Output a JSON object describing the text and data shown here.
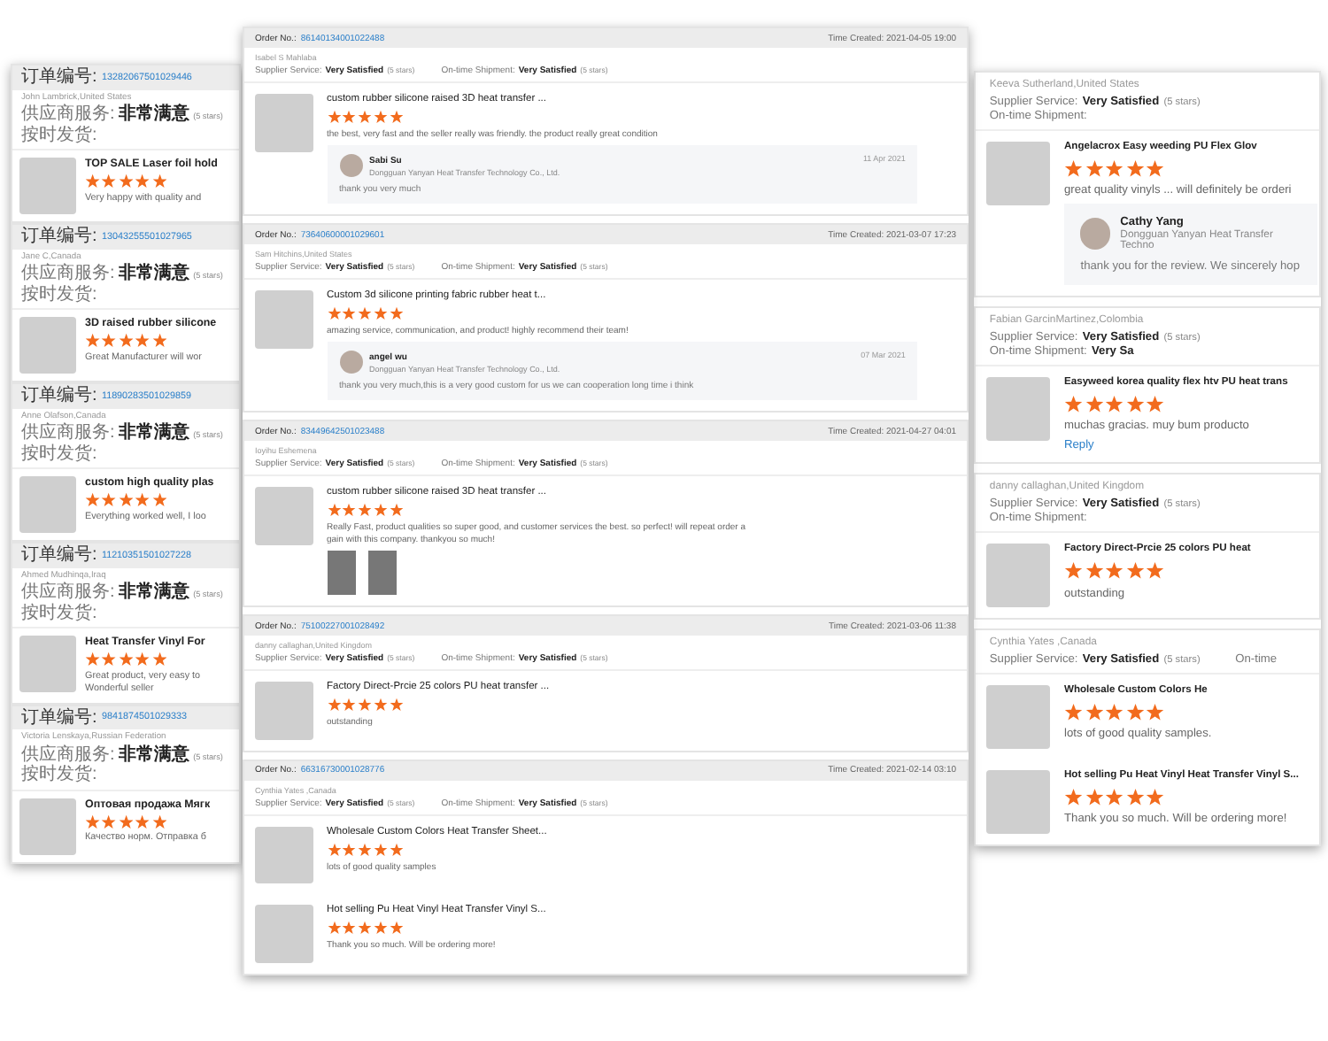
{
  "left_panel": {
    "orders": [
      {
        "order_label": "订单编号:",
        "order_no": "13282067501029446",
        "buyer": "John Lambrick,United States",
        "service": {
          "label": "供应商服务:",
          "value": "非常满意",
          "stars_text": "(5 stars)"
        },
        "shipment": {
          "label": "按时发货:"
        },
        "items": [
          {
            "title": "TOP SALE Laser foil hold",
            "stars": 5,
            "comment": [
              "Very happy with quality and"
            ]
          }
        ]
      },
      {
        "order_label": "订单编号:",
        "order_no": "13043255501027965",
        "buyer": "Jane C,Canada",
        "service": {
          "label": "供应商服务:",
          "value": "非常满意",
          "stars_text": "(5 stars)"
        },
        "shipment": {
          "label": "按时发货:"
        },
        "items": [
          {
            "title": "3D raised rubber silicone",
            "stars": 5,
            "comment": [
              "Great Manufacturer will wor"
            ]
          }
        ]
      },
      {
        "order_label": "订单编号:",
        "order_no": "11890283501029859",
        "buyer": "Anne Olafson,Canada",
        "service": {
          "label": "供应商服务:",
          "value": "非常满意",
          "stars_text": "(5 stars)"
        },
        "shipment": {
          "label": "按时发货:"
        },
        "items": [
          {
            "title": "custom high quality plas",
            "stars": 5,
            "comment": [
              "Everything worked well, I loo"
            ]
          }
        ]
      },
      {
        "order_label": "订单编号:",
        "order_no": "11210351501027228",
        "buyer": "Ahmed Mudhinqa,Iraq",
        "service": {
          "label": "供应商服务:",
          "value": "非常满意",
          "stars_text": "(5 stars)"
        },
        "shipment": {
          "label": "按时发货:"
        },
        "items": [
          {
            "title": "Heat Transfer Vinyl For",
            "stars": 5,
            "comment": [
              "Great product, very easy to",
              "Wonderful seller"
            ]
          }
        ]
      },
      {
        "order_label": "订单编号:",
        "order_no": "9841874501029333",
        "buyer": "Victoria Lenskaya,Russian Federation",
        "service": {
          "label": "供应商服务:",
          "value": "非常满意",
          "stars_text": "(5 stars)"
        },
        "shipment": {
          "label": "按时发货:"
        },
        "items": [
          {
            "title": "Оптовая продажа Мягк",
            "stars": 5,
            "comment": [
              "Качество норм. Отправка б"
            ]
          }
        ]
      }
    ]
  },
  "middle_panel": {
    "orders": [
      {
        "order_label": "Order No.:",
        "order_no": "86140134001022488",
        "time_created": "Time Created: 2021-04-05 19:00",
        "buyer": "Isabel S Mahlaba",
        "service": {
          "label": "Supplier Service:",
          "value": "Very Satisfied",
          "stars_text": "(5 stars)"
        },
        "shipment": {
          "label": "On-time Shipment:",
          "value": "Very Satisfied",
          "stars_text": "(5 stars)"
        },
        "items": [
          {
            "title": "custom rubber silicone raised 3D heat transfer ...",
            "stars": 5,
            "comment": [
              "the best, very fast and the seller really was friendly. the product really great condition"
            ],
            "reply": {
              "name": "Sabi Su",
              "date": "11 Apr 2021",
              "company": "Dongguan Yanyan Heat Transfer Technology Co., Ltd.",
              "text": "thank you very much"
            }
          }
        ]
      },
      {
        "order_label": "Order No.:",
        "order_no": "73640600001029601",
        "time_created": "Time Created: 2021-03-07 17:23",
        "buyer": "Sam Hitchins,United States",
        "service": {
          "label": "Supplier Service:",
          "value": "Very Satisfied",
          "stars_text": "(5 stars)"
        },
        "shipment": {
          "label": "On-time Shipment:",
          "value": "Very Satisfied",
          "stars_text": "(5 stars)"
        },
        "items": [
          {
            "title": "Custom 3d silicone printing fabric rubber heat t...",
            "stars": 5,
            "comment": [
              "amazing service, communication, and product! highly recommend their team!"
            ],
            "reply": {
              "name": "angel wu",
              "date": "07 Mar 2021",
              "company": "Dongguan Yanyan Heat Transfer Technology Co., Ltd.",
              "text": "thank you very much,this is a very good custom for us we can cooperation long time i think"
            }
          }
        ]
      },
      {
        "order_label": "Order No.:",
        "order_no": "83449642501023488",
        "time_created": "Time Created: 2021-04-27 04:01",
        "buyer": "Ioyihu Eshemena",
        "service": {
          "label": "Supplier Service:",
          "value": "Very Satisfied",
          "stars_text": "(5 stars)"
        },
        "shipment": {
          "label": "On-time Shipment:",
          "value": "Very Satisfied",
          "stars_text": "(5 stars)"
        },
        "items": [
          {
            "title": "custom rubber silicone raised 3D heat transfer ...",
            "stars": 5,
            "comment": [
              "Really Fast, product qualities so super good, and customer services the best. so perfect! will repeat order a",
              "gain with this company. thankyou so much!"
            ],
            "photos": [
              {
                "kind": "photo"
              },
              {
                "kind": "photo"
              }
            ]
          }
        ]
      },
      {
        "order_label": "Order No.:",
        "order_no": "75100227001028492",
        "time_created": "Time Created: 2021-03-06 11:38",
        "buyer": "danny callaghan,United Kingdom",
        "service": {
          "label": "Supplier Service:",
          "value": "Very Satisfied",
          "stars_text": "(5 stars)"
        },
        "shipment": {
          "label": "On-time Shipment:",
          "value": "Very Satisfied",
          "stars_text": "(5 stars)"
        },
        "items": [
          {
            "title": "Factory Direct-Prcie 25 colors PU heat transfer ...",
            "stars": 5,
            "comment": [
              "outstanding"
            ]
          }
        ]
      },
      {
        "order_label": "Order No.:",
        "order_no": "66316730001028776",
        "time_created": "Time Created: 2021-02-14 03:10",
        "buyer": "Cynthia Yates ,Canada",
        "service": {
          "label": "Supplier Service:",
          "value": "Very Satisfied",
          "stars_text": "(5 stars)"
        },
        "shipment": {
          "label": "On-time Shipment:",
          "value": "Very Satisfied",
          "stars_text": "(5 stars)"
        },
        "items": [
          {
            "title": "Wholesale Custom Colors Heat Transfer Sheet...",
            "stars": 5,
            "comment": [
              "lots of good quality samples"
            ]
          },
          {
            "title": "Hot selling Pu Heat Vinyl Heat Transfer Vinyl S...",
            "stars": 5,
            "comment": [
              "Thank you so much. Will be ordering more!"
            ]
          }
        ]
      }
    ]
  },
  "right_panel": {
    "orders": [
      {
        "buyer": "Keeva Sutherland,United States",
        "service": {
          "label": "Supplier Service:",
          "value": "Very Satisfied",
          "stars_text": "(5 stars)"
        },
        "shipment": {
          "label": "On-time Shipment:"
        },
        "items": [
          {
            "title": "Angelacrox Easy weeding PU Flex Glov",
            "stars": 5,
            "comment": [
              "great quality vinyls ... will definitely be orderi"
            ],
            "reply": {
              "name": "Cathy Yang",
              "company": "Dongguan Yanyan Heat Transfer Techno",
              "text": "thank you for the review. We sincerely hop"
            }
          }
        ]
      },
      {
        "buyer": "Fabian GarcinMartinez,Colombia",
        "service": {
          "label": "Supplier Service:",
          "value": "Very Satisfied",
          "stars_text": "(5 stars)"
        },
        "shipment": {
          "label": "On-time Shipment:",
          "value": "Very Sa"
        },
        "items": [
          {
            "title": "Easyweed korea quality flex htv PU heat trans",
            "stars": 5,
            "comment": [
              "muchas gracias. muy bum producto"
            ],
            "reply_link": "Reply"
          }
        ]
      },
      {
        "buyer": "danny callaghan,United Kingdom",
        "service": {
          "label": "Supplier Service:",
          "value": "Very Satisfied",
          "stars_text": "(5 stars)"
        },
        "shipment": {
          "label": "On-time Shipment:"
        },
        "items": [
          {
            "title": "Factory Direct-Prcie 25 colors PU heat",
            "stars": 5,
            "comment": [
              "outstanding"
            ]
          }
        ]
      },
      {
        "buyer": "Cynthia Yates ,Canada",
        "service": {
          "label": "Supplier Service:",
          "value": "Very Satisfied",
          "stars_text": "(5 stars)"
        },
        "shipment": {
          "label": "On-time"
        },
        "items": [
          {
            "title": "Wholesale Custom Colors He",
            "stars": 5,
            "comment": [
              "lots of good quality samples."
            ]
          },
          {
            "title": "Hot selling Pu Heat Vinyl Heat Transfer Vinyl S...",
            "stars": 5,
            "comment": [
              "Thank you so much. Will be ordering more!"
            ]
          }
        ]
      }
    ]
  }
}
